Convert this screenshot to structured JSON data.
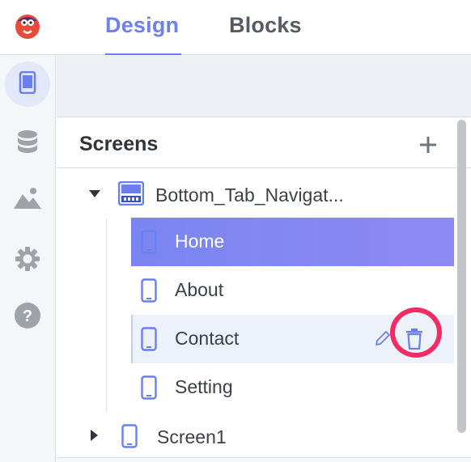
{
  "header": {
    "tabs": [
      {
        "label": "Design",
        "active": true
      },
      {
        "label": "Blocks",
        "active": false
      }
    ]
  },
  "rail": {
    "items": [
      {
        "icon": "phone-screen-icon",
        "active": true
      },
      {
        "icon": "database-icon",
        "active": false
      },
      {
        "icon": "image-icon",
        "active": false
      },
      {
        "icon": "gear-icon",
        "active": false
      },
      {
        "icon": "help-icon",
        "active": false
      }
    ]
  },
  "screens_panel": {
    "title": "Screens",
    "add_icon": "plus-icon",
    "tree": {
      "group_label": "Bottom_Tab_Navigat...",
      "group_expanded": true,
      "children": [
        {
          "label": "Home",
          "selected": true
        },
        {
          "label": "About",
          "selected": false
        },
        {
          "label": "Contact",
          "selected": false,
          "hovered": true
        },
        {
          "label": "Setting",
          "selected": false
        }
      ],
      "root_label": "Screen1",
      "root_expanded": false
    }
  },
  "colors": {
    "accent": "#6d80ec",
    "selected_start": "#7985f1",
    "selected_end": "#8f8af4",
    "highlight_ring": "#f22b62",
    "icon_blue": "#6b7ef0",
    "rail_icon": "#9ea3a9"
  }
}
